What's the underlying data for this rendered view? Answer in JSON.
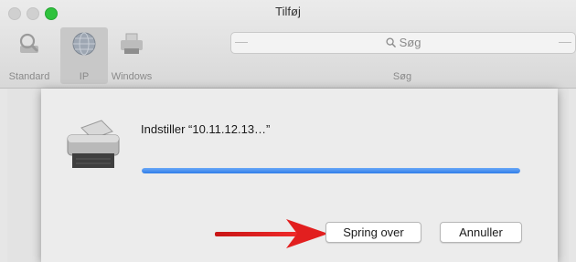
{
  "window": {
    "title": "Tilføj"
  },
  "toolbar": {
    "items": [
      {
        "label": "Standard",
        "icon": "default-printer-icon"
      },
      {
        "label": "IP",
        "icon": "globe-icon"
      },
      {
        "label": "Windows",
        "icon": "windows-printer-icon"
      }
    ],
    "active": "IP"
  },
  "search": {
    "placeholder": "Søg",
    "label": "Søg",
    "icon": "magnifier-icon"
  },
  "dialog": {
    "message": "Indstiller “10.11.12.13…”",
    "progress": 1.0,
    "skip_label": "Spring over",
    "cancel_label": "Annuller",
    "icon": "printer-icon",
    "annotation": "red-arrow-icon"
  },
  "colors": {
    "progress": "#2f7de9",
    "annotation_arrow": "#e21f1f",
    "maximize": "#2fc23d"
  }
}
